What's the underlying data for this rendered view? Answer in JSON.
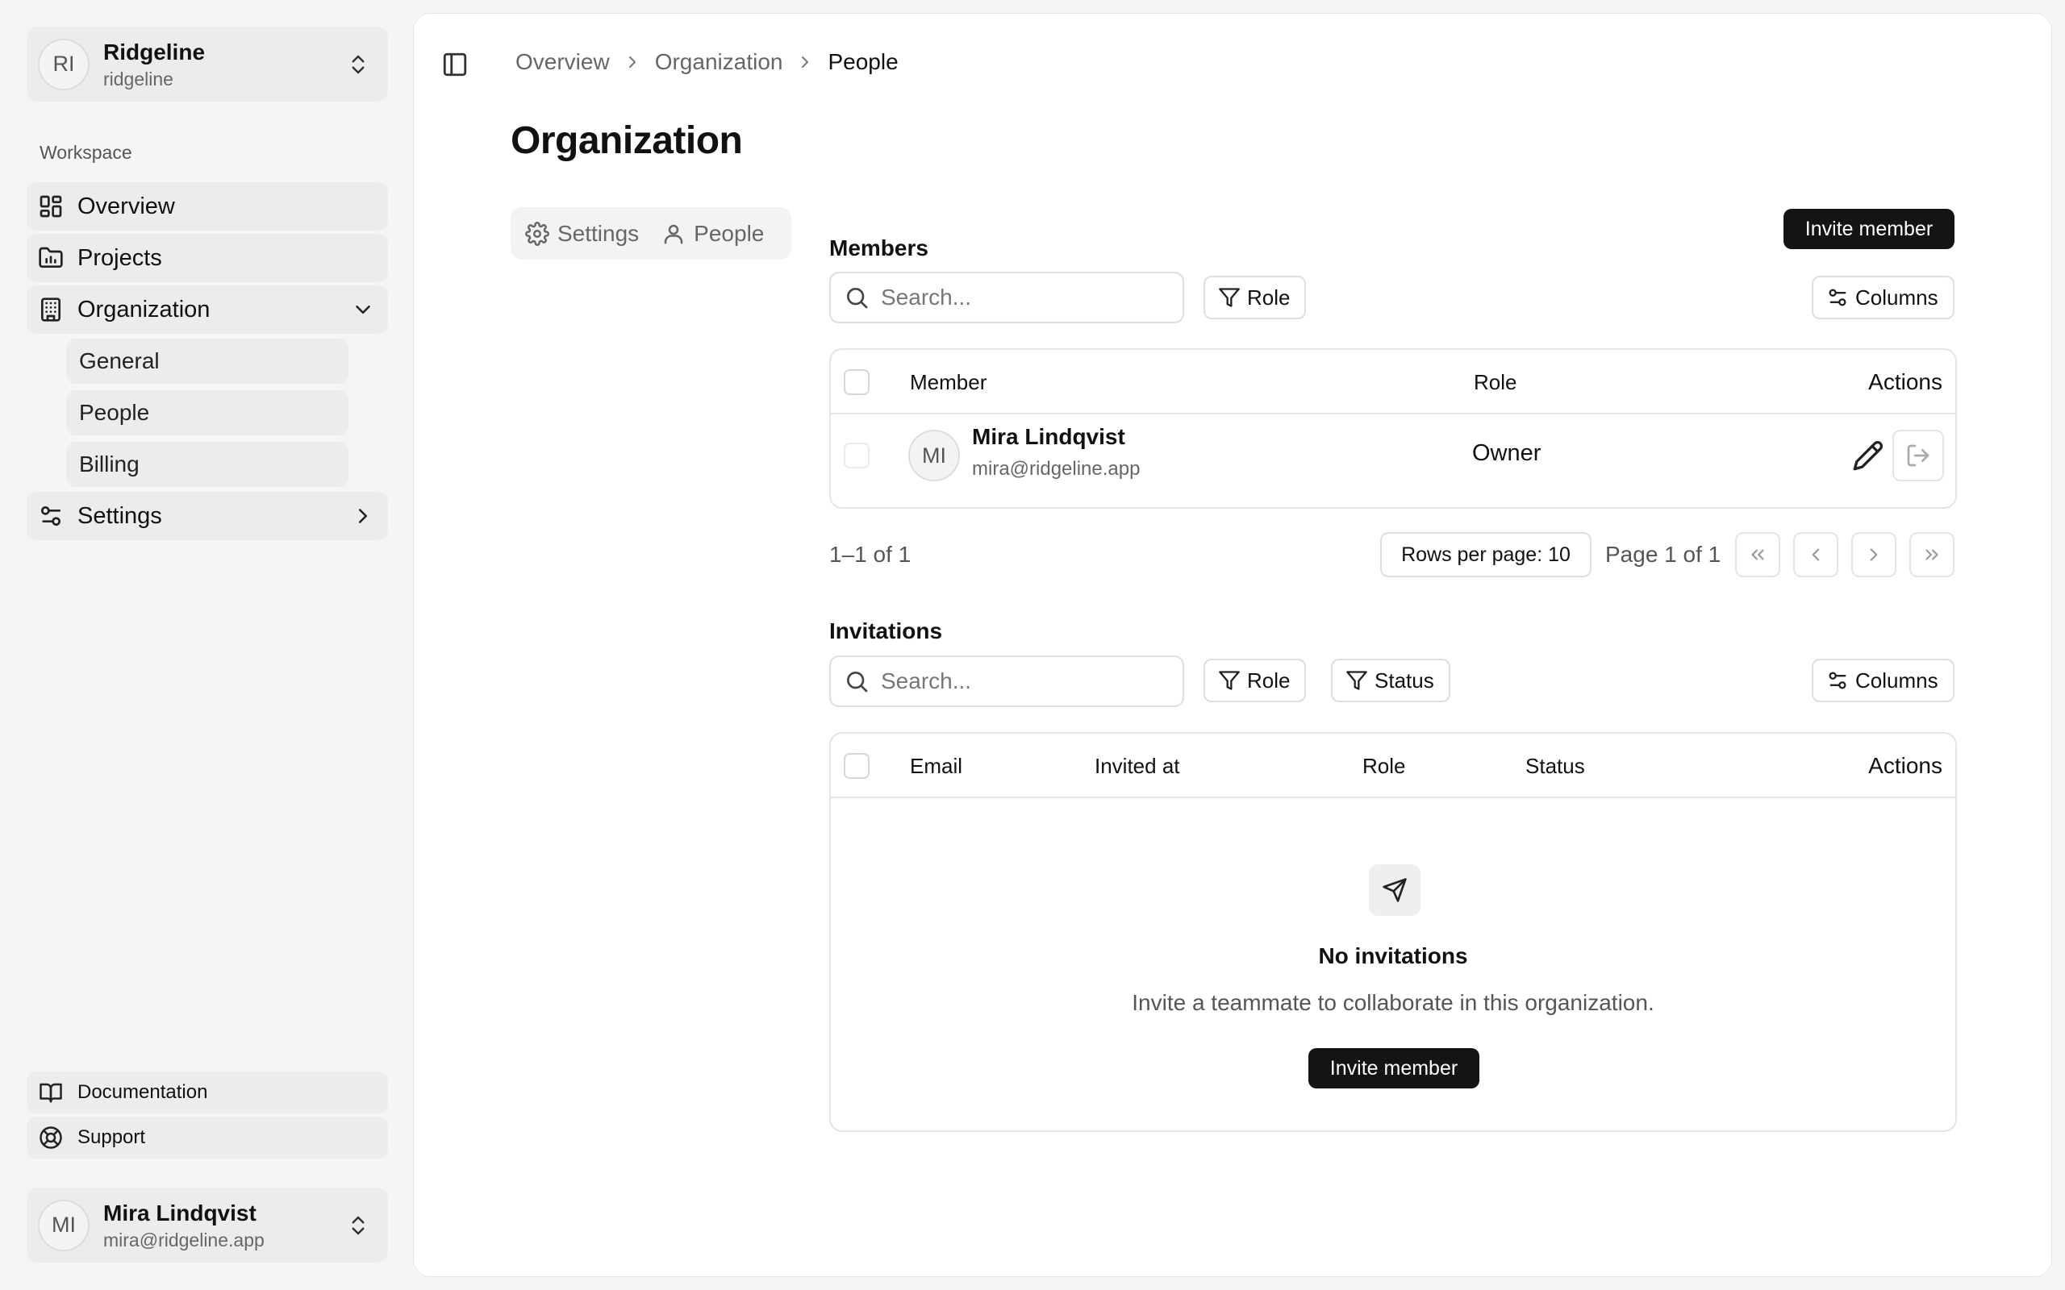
{
  "sidebar": {
    "org": {
      "initials": "RI",
      "name": "Ridgeline",
      "slug": "ridgeline"
    },
    "section_label": "Workspace",
    "nav": {
      "overview": "Overview",
      "projects": "Projects",
      "organization": "Organization",
      "settings": "Settings"
    },
    "sub_nav": {
      "general": "General",
      "people": "People",
      "billing": "Billing"
    },
    "footer": {
      "documentation": "Documentation",
      "support": "Support"
    },
    "user": {
      "initials": "MI",
      "name": "Mira Lindqvist",
      "email": "mira@ridgeline.app"
    }
  },
  "header": {
    "breadcrumb": [
      "Overview",
      "Organization",
      "People"
    ],
    "title": "Organization"
  },
  "tabs": [
    {
      "label": "Settings",
      "icon": "gear-icon"
    },
    {
      "label": "People",
      "icon": "user-icon"
    }
  ],
  "members": {
    "title": "Members",
    "invite_label": "Invite member",
    "search_placeholder": "Search...",
    "role_filter": "Role",
    "columns_label": "Columns",
    "headers": {
      "member": "Member",
      "role": "Role",
      "actions": "Actions"
    },
    "rows": [
      {
        "initials": "MI",
        "name": "Mira Lindqvist",
        "email": "mira@ridgeline.app",
        "role": "Owner"
      }
    ],
    "pagination": {
      "count": "1–1 of 1",
      "rows_per_page": "Rows per page: 10",
      "page_info": "Page 1 of 1"
    }
  },
  "invitations": {
    "title": "Invitations",
    "search_placeholder": "Search...",
    "role_filter": "Role",
    "status_filter": "Status",
    "columns_label": "Columns",
    "headers": {
      "email": "Email",
      "invited_at": "Invited at",
      "role": "Role",
      "status": "Status",
      "actions": "Actions"
    },
    "empty": {
      "title": "No invitations",
      "subtitle": "Invite a teammate to collaborate in this organization.",
      "button": "Invite member"
    }
  }
}
